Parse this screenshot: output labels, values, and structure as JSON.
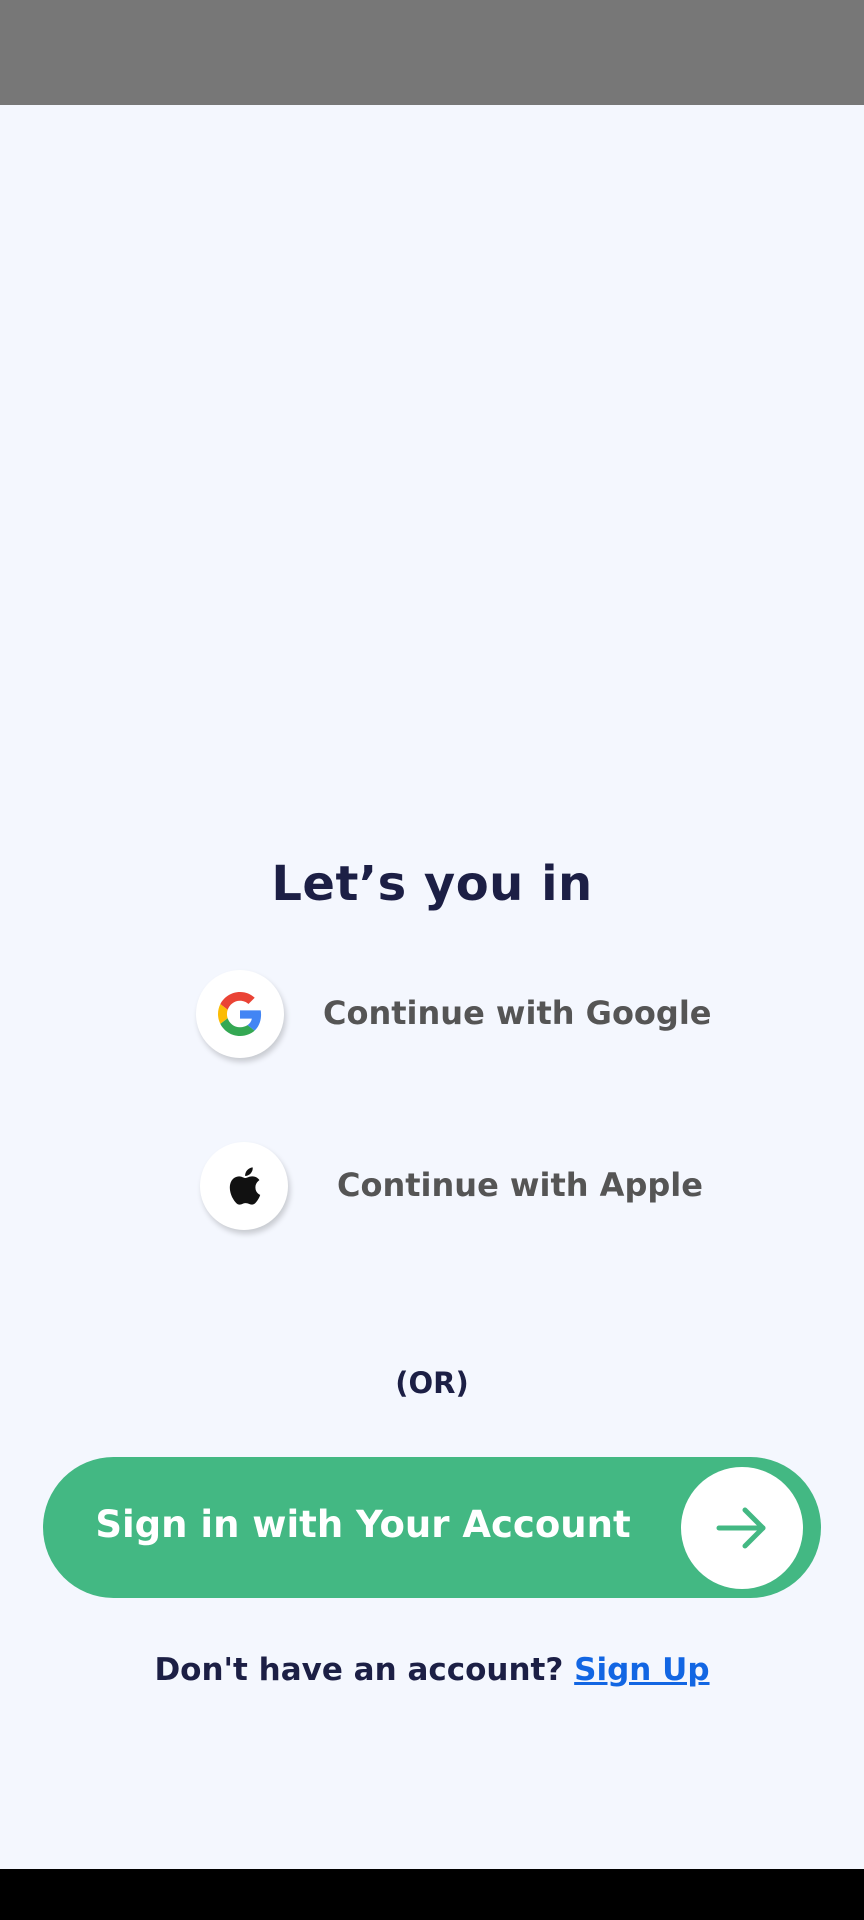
{
  "header": {
    "title": "Let’s you in"
  },
  "social": {
    "google": {
      "label": "Continue with Google",
      "icon": "google-icon"
    },
    "apple": {
      "label": "Continue with Apple",
      "icon": "apple-icon"
    }
  },
  "divider": {
    "text": "(OR)"
  },
  "signin": {
    "label": "Sign in with Your Account",
    "icon": "arrow-right-icon"
  },
  "signup": {
    "prompt": "Don't have an account?",
    "link_label": "Sign Up"
  },
  "colors": {
    "background": "#f4f7fe",
    "primary": "#43b883",
    "title_text": "#1c1f45",
    "link": "#1266e3",
    "status_bar": "#777777",
    "nav_bar": "#000000"
  }
}
